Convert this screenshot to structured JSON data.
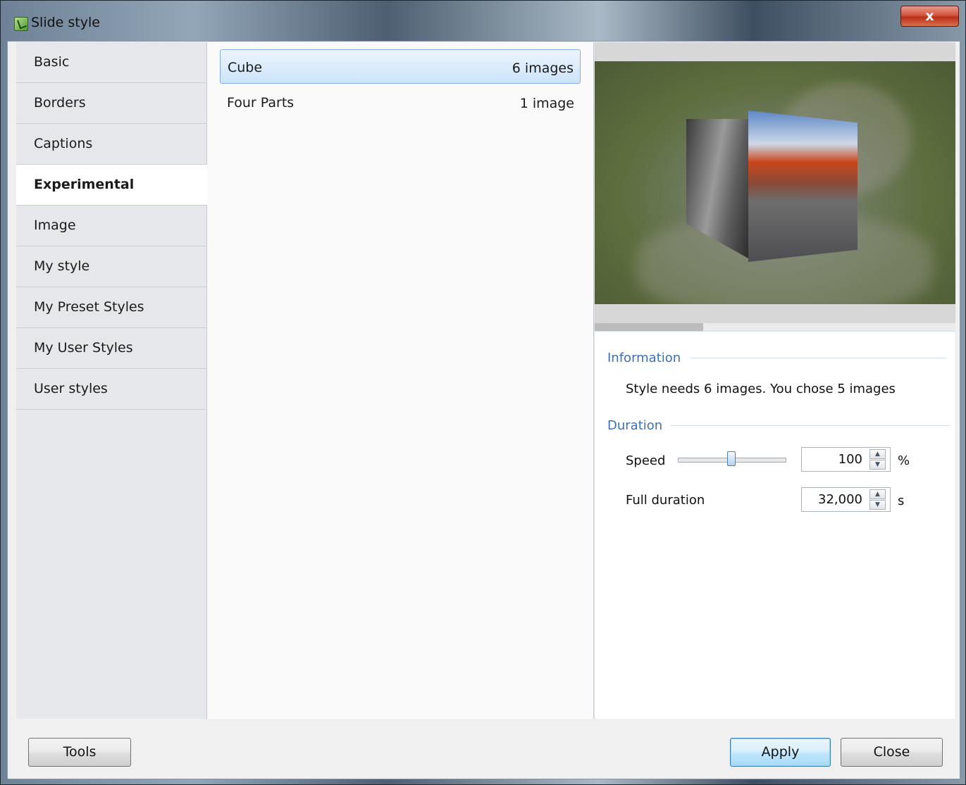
{
  "window": {
    "title": "Slide style",
    "close_glyph": "x"
  },
  "sidebar": {
    "items": [
      {
        "label": "Basic"
      },
      {
        "label": "Borders"
      },
      {
        "label": "Captions"
      },
      {
        "label": "Experimental",
        "selected": true
      },
      {
        "label": "Image"
      },
      {
        "label": "My style"
      },
      {
        "label": "My Preset Styles"
      },
      {
        "label": "My User Styles"
      },
      {
        "label": "User styles"
      }
    ]
  },
  "style_list": {
    "rows": [
      {
        "name": "Cube",
        "count": "6 images",
        "selected": true
      },
      {
        "name": "Four Parts",
        "count": "1 image"
      }
    ]
  },
  "preview": {
    "icon": "cube-preview-image",
    "progress_fraction": 0.3
  },
  "information": {
    "group_title": "Information",
    "message": "Style needs 6 images. You chose 5 images"
  },
  "duration": {
    "group_title": "Duration",
    "speed": {
      "label": "Speed",
      "value": "100",
      "unit": "%",
      "slider_fraction": 0.5
    },
    "full_duration": {
      "label": "Full duration",
      "value": "32,000",
      "unit": "s"
    }
  },
  "footer": {
    "tools_label": "Tools",
    "apply_label": "Apply",
    "close_label": "Close"
  },
  "colors": {
    "accent": "#3b6fbb",
    "selection": "#cde4fb",
    "close_button": "#c7432a"
  }
}
